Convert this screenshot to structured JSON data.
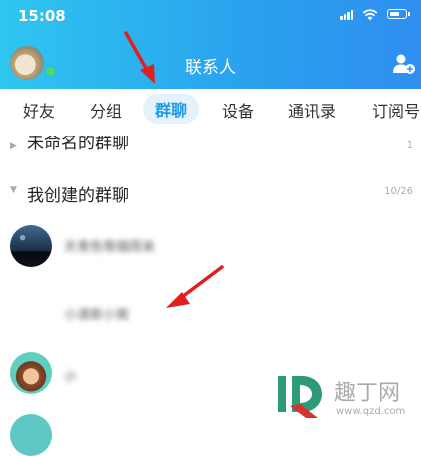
{
  "status_bar": {
    "time": "15:08"
  },
  "header": {
    "title": "联系人"
  },
  "icons": {
    "avatar": "user-avatar",
    "add_contact": "person-plus-icon",
    "wifi": "wifi-icon",
    "battery": "battery-icon",
    "signal": "signal-icon",
    "caret_collapsed": "caret-right-icon",
    "caret_expanded": "caret-down-icon"
  },
  "tabs": [
    {
      "label": "好友"
    },
    {
      "label": "分组"
    },
    {
      "label": "群聊",
      "active": true
    },
    {
      "label": "设备"
    },
    {
      "label": "通讯录"
    },
    {
      "label": "订阅号"
    }
  ],
  "groups": [
    {
      "name": "未命名的群聊",
      "count": "1",
      "expanded": false
    },
    {
      "name": "我创建的群聊",
      "count": "10/26",
      "expanded": true
    }
  ],
  "chats": [
    {
      "name": "天青色等烟雨来"
    },
    {
      "name": "小清新小窝"
    },
    {
      "name": "小"
    }
  ],
  "watermark": {
    "brand": "趣丁网",
    "url": "www.qzd.com"
  },
  "colors": {
    "header_start": "#2fc6f0",
    "header_end": "#2f8ef0",
    "accent": "#1f9bea",
    "arrow": "#e0201e",
    "online": "#4cd964"
  }
}
